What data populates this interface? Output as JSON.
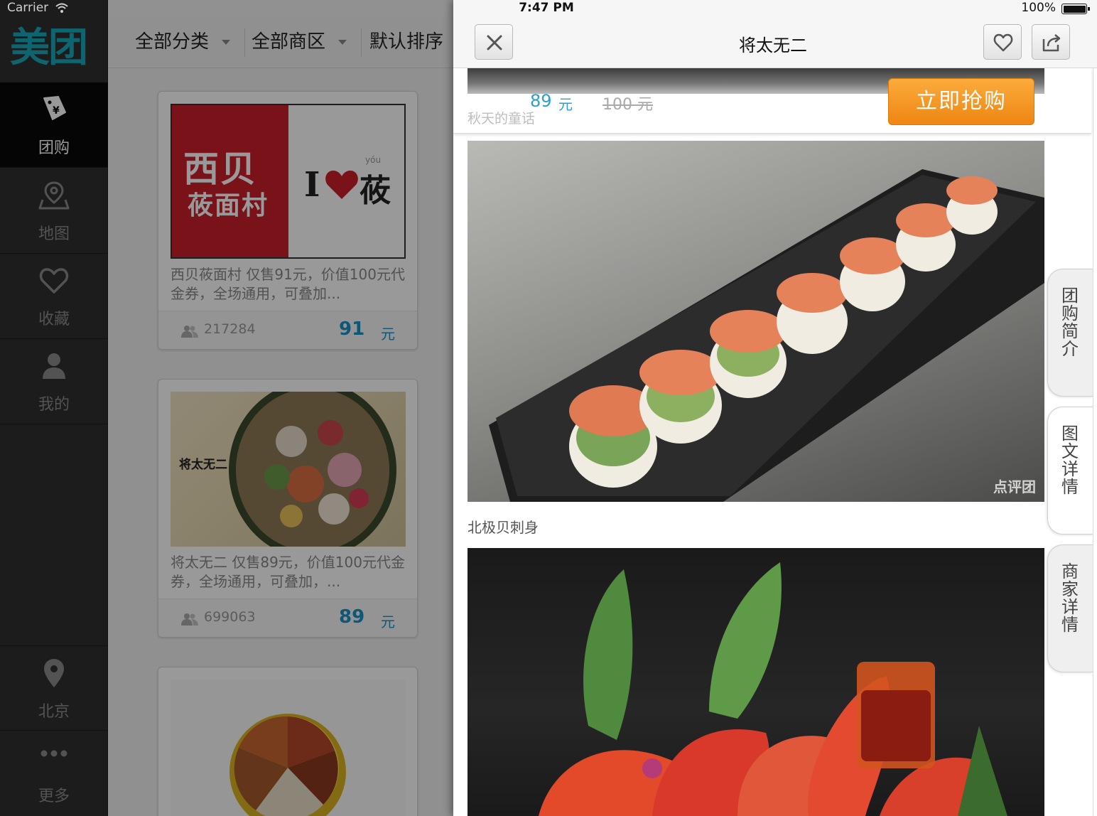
{
  "status_bar": {
    "carrier": "Carrier",
    "time": "7:47 PM",
    "battery": "100%"
  },
  "sidebar": {
    "logo": "美团",
    "items": [
      {
        "label": "团购",
        "icon": "coupon-tag-icon",
        "active": true
      },
      {
        "label": "地图",
        "icon": "map-pin-icon",
        "active": false
      },
      {
        "label": "收藏",
        "icon": "heart-icon",
        "active": false
      },
      {
        "label": "我的",
        "icon": "person-icon",
        "active": false
      }
    ],
    "bottom_items": [
      {
        "label": "北京",
        "icon": "location-icon"
      },
      {
        "label": "更多",
        "icon": "more-dots-icon"
      }
    ]
  },
  "filters": [
    {
      "label": "全部分类"
    },
    {
      "label": "全部商区"
    },
    {
      "label": "默认排序"
    }
  ],
  "deals": [
    {
      "brand_title": "西贝",
      "brand_sub": "莜面村",
      "brand_slogan_i": "I",
      "brand_slogan_you": "莜",
      "brand_pinyin": "yóu",
      "description": "西贝莜面村 仅售91元，价值100元代金券，全场通用，可叠加...",
      "buyers": "217284",
      "price": "91",
      "unit": "元"
    },
    {
      "brand_title": "将太无二",
      "description": "将太无二 仅售89元，价值100元代金券，全场通用，可叠加，...",
      "buyers": "699063",
      "price": "89",
      "unit": "元"
    },
    {
      "description": ""
    }
  ],
  "detail": {
    "title": "将太无二",
    "close_icon": "close-icon",
    "favorite_icon": "heart-outline-icon",
    "share_icon": "share-icon",
    "peek_caption": "秋天的童话",
    "price": "89",
    "price_unit": "元",
    "original_price": "100 元",
    "buy_button": "立即抢购",
    "watermark": "点评团",
    "photos": [
      {
        "caption": "北极贝刺身",
        "subject": "sushi-roll-platter"
      },
      {
        "caption": "",
        "subject": "sashimi-plate"
      }
    ],
    "side_tabs": [
      {
        "label": "团购简介",
        "active": false
      },
      {
        "label": "图文详情",
        "active": true
      },
      {
        "label": "商家详情",
        "active": false
      }
    ]
  },
  "colors": {
    "brand_teal": "#19a8b9",
    "price_blue": "#1c91c7",
    "buy_orange": "#f39a25",
    "xibei_red": "#cc1e2c"
  }
}
